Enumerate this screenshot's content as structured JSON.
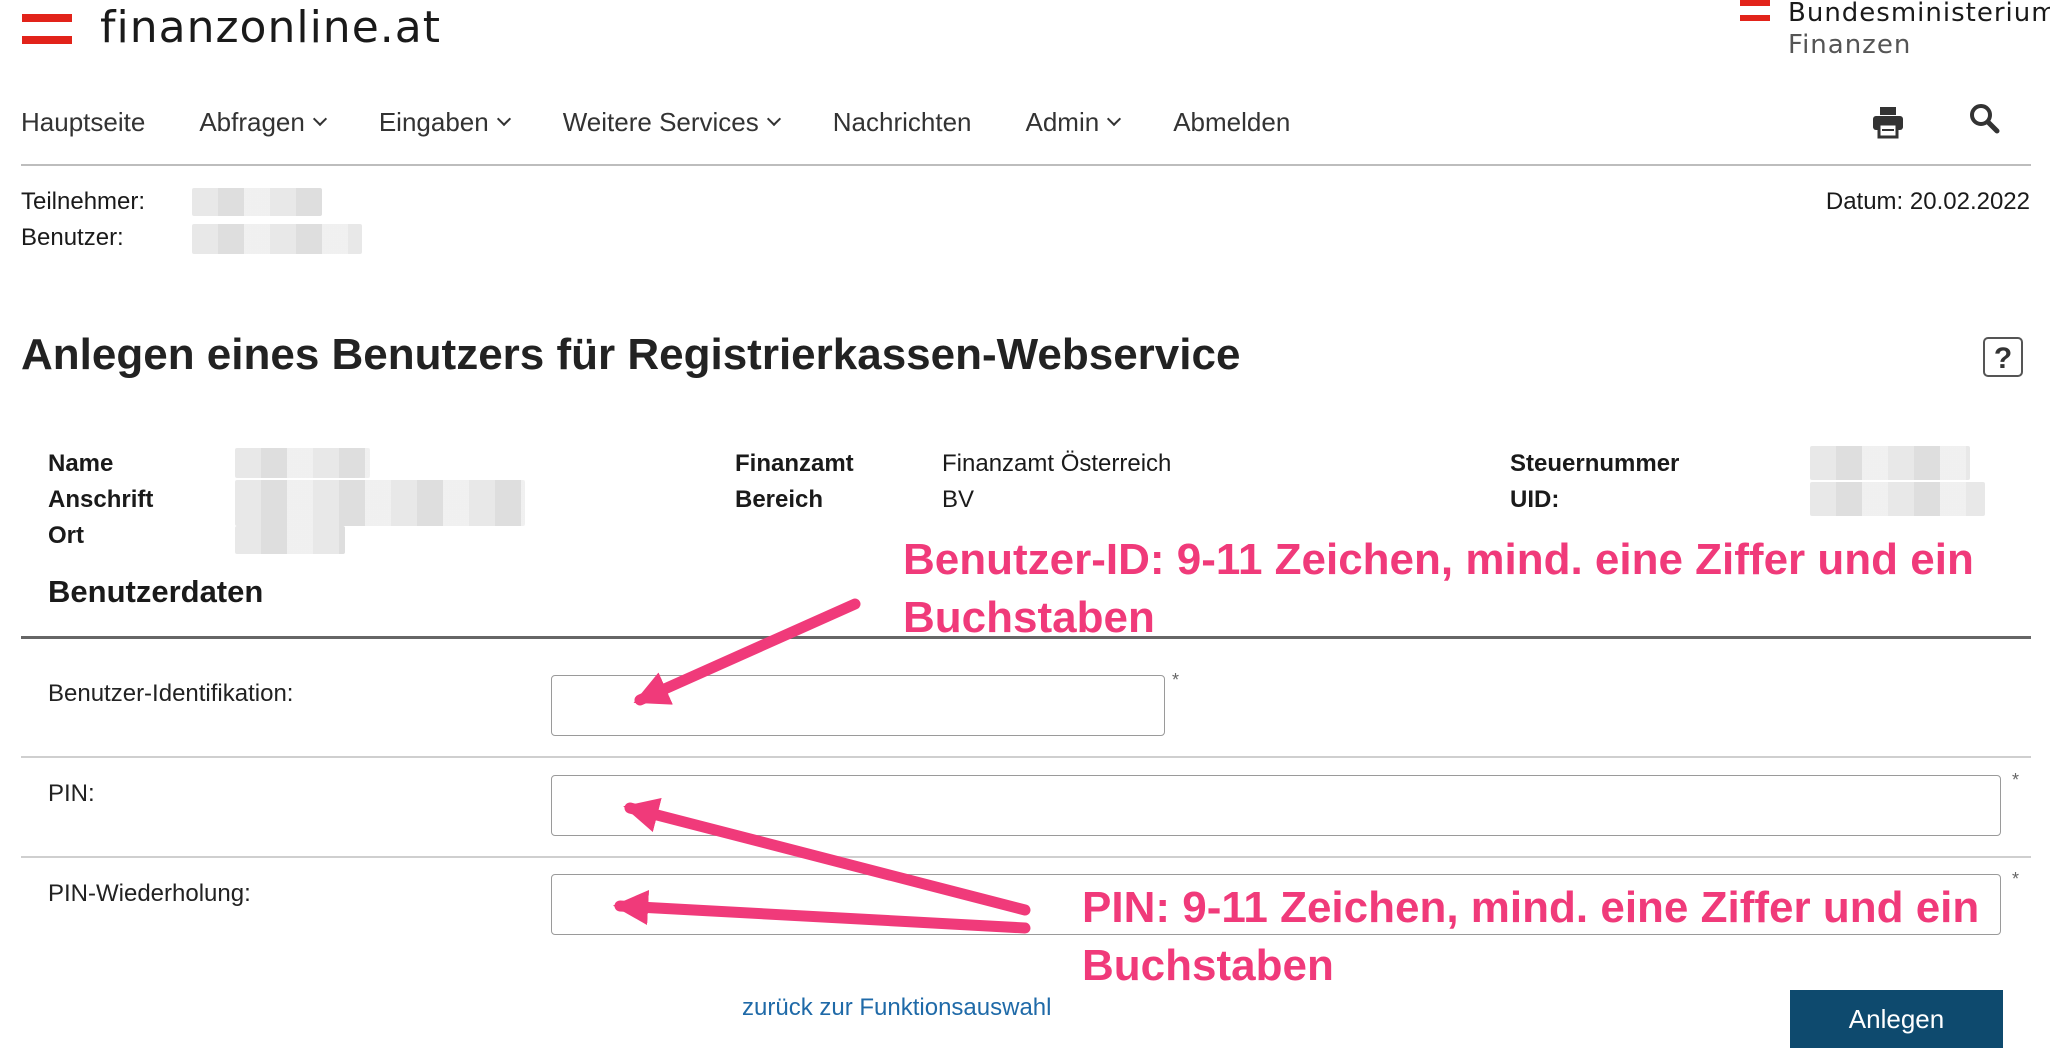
{
  "header": {
    "brand": "finanzonline.at",
    "ministry_line1": "Bundesministerium",
    "ministry_line2": "Finanzen",
    "brand_color": "#e2231a"
  },
  "nav": {
    "items": [
      {
        "label": "Hauptseite",
        "dropdown": false
      },
      {
        "label": "Abfragen",
        "dropdown": true
      },
      {
        "label": "Eingaben",
        "dropdown": true
      },
      {
        "label": "Weitere Services",
        "dropdown": true
      },
      {
        "label": "Nachrichten",
        "dropdown": false
      },
      {
        "label": "Admin",
        "dropdown": true
      },
      {
        "label": "Abmelden",
        "dropdown": false
      }
    ],
    "print_icon": "printer-icon",
    "search_icon": "search-icon"
  },
  "session": {
    "participant_label": "Teilnehmer:",
    "user_label": "Benutzer:",
    "date": "Datum: 20.02.2022"
  },
  "page": {
    "title": "Anlegen eines Benutzers für Registrierkassen-Webservice",
    "help": "?"
  },
  "summary": {
    "name_label": "Name",
    "address_label": "Anschrift",
    "city_label": "Ort",
    "office_label": "Finanzamt",
    "office_value": "Finanzamt Österreich",
    "area_label": "Bereich",
    "area_value": "BV",
    "taxno_label": "Steuernummer",
    "uid_label": "UID:"
  },
  "form": {
    "section_title": "Benutzerdaten",
    "user_id_label": "Benutzer-Identifikation:",
    "pin_label": "PIN:",
    "pin_repeat_label": "PIN-Wiederholung:",
    "user_id_value": "",
    "pin_value": "",
    "pin_repeat_value": "",
    "required_marker": "*",
    "back_link": "zurück zur Funktionsauswahl",
    "submit": "Anlegen",
    "submit_color": "#0e4a6e"
  },
  "annotations": {
    "user_id_note_line1": "Benutzer-ID: 9-11 Zeichen, mind. eine Ziffer und ein",
    "user_id_note_line2": "Buchstaben",
    "pin_note_line1": "PIN: 9-11 Zeichen, mind. eine Ziffer und ein",
    "pin_note_line2": "Buchstaben",
    "color": "#f03a7a"
  }
}
